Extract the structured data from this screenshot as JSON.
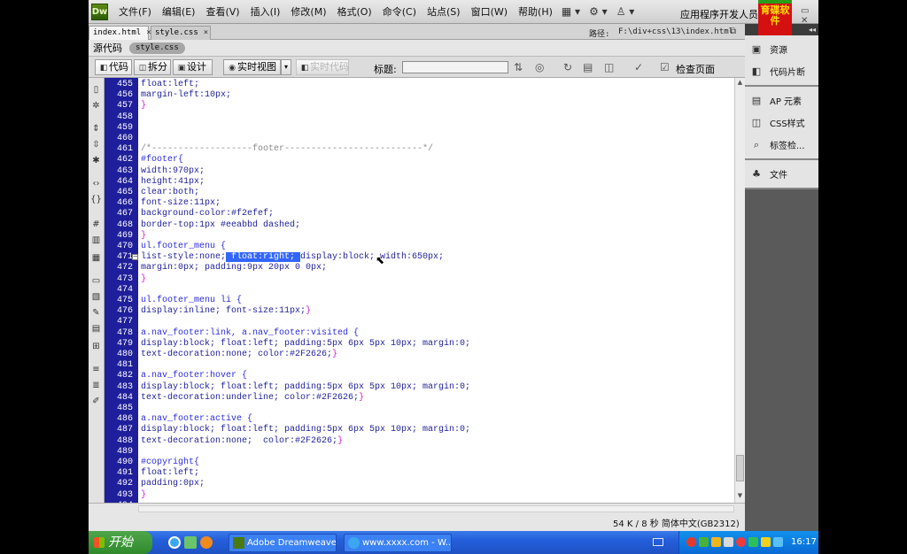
{
  "menubar": {
    "logo_text": "Dw",
    "items": [
      "文件(F)",
      "编辑(E)",
      "查看(V)",
      "插入(I)",
      "修改(M)",
      "格式(O)",
      "命令(C)",
      "站点(S)",
      "窗口(W)",
      "帮助(H)"
    ],
    "tools": [
      "▦ ▾",
      "⚙ ▾",
      "♙ ▾"
    ],
    "workspace": "应用程序开发人员",
    "brand_logo": "育碟软件",
    "window_controls": "▭ ✕"
  },
  "doc_tabs": {
    "tabs": [
      {
        "label": "index.html",
        "close": "×"
      },
      {
        "label": "style.css",
        "close": "×"
      }
    ],
    "path_label": "路径:",
    "path_value": "F:\\div+css\\13\\index.html",
    "restore_icon": "⧉"
  },
  "related_files": {
    "source_code": "源代码",
    "style_file": "style.css"
  },
  "doc_toolbar": {
    "code": "代码",
    "split": "拆分",
    "design": "设计",
    "live_view": "实时视图",
    "live_view_dropdown": "▾",
    "live_code": "实时代码",
    "title_label": "标题:",
    "title_value": "",
    "check_page": "检查页面"
  },
  "editor": {
    "lines": [
      {
        "n": "455",
        "segs": [
          {
            "c": "prop",
            "t": "float:left;"
          }
        ]
      },
      {
        "n": "456",
        "segs": [
          {
            "c": "prop",
            "t": "margin-left:10px;"
          }
        ]
      },
      {
        "n": "457",
        "segs": [
          {
            "c": "brace",
            "t": "}"
          }
        ]
      },
      {
        "n": "458",
        "segs": []
      },
      {
        "n": "459",
        "segs": []
      },
      {
        "n": "460",
        "segs": []
      },
      {
        "n": "461",
        "segs": [
          {
            "c": "comment",
            "t": "/*-------------------footer--------------------------*/"
          }
        ]
      },
      {
        "n": "462",
        "segs": [
          {
            "c": "sel",
            "t": "#footer{"
          }
        ]
      },
      {
        "n": "463",
        "segs": [
          {
            "c": "prop",
            "t": "width:970px;"
          }
        ]
      },
      {
        "n": "464",
        "segs": [
          {
            "c": "prop",
            "t": "height:41px;"
          }
        ]
      },
      {
        "n": "465",
        "segs": [
          {
            "c": "prop",
            "t": "clear:both;"
          }
        ]
      },
      {
        "n": "466",
        "segs": [
          {
            "c": "prop",
            "t": "font-size:11px;"
          }
        ]
      },
      {
        "n": "467",
        "segs": [
          {
            "c": "prop",
            "t": "background-color:#f2efef;"
          }
        ]
      },
      {
        "n": "468",
        "segs": [
          {
            "c": "prop",
            "t": "border-top:1px #eeabbd dashed;"
          }
        ]
      },
      {
        "n": "469",
        "segs": [
          {
            "c": "brace",
            "t": "}"
          }
        ]
      },
      {
        "n": "470",
        "segs": [
          {
            "c": "sel",
            "t": "ul.footer_menu {"
          }
        ]
      },
      {
        "n": "471",
        "fold": "−",
        "segs": [
          {
            "c": "prop",
            "t": "list-style:none;"
          },
          {
            "c": "hl",
            "t": " float:right; "
          },
          {
            "c": "prop",
            "t": "display:block; width:650px;"
          }
        ]
      },
      {
        "n": "472",
        "segs": [
          {
            "c": "prop",
            "t": "margin:0px; padding:9px 20px 0 0px;"
          }
        ]
      },
      {
        "n": "473",
        "segs": [
          {
            "c": "brace",
            "t": "}"
          }
        ]
      },
      {
        "n": "474",
        "segs": []
      },
      {
        "n": "475",
        "segs": [
          {
            "c": "sel",
            "t": "ul.footer_menu li {"
          }
        ]
      },
      {
        "n": "476",
        "segs": [
          {
            "c": "prop",
            "t": "display:inline; font-size:11px;"
          },
          {
            "c": "brace",
            "t": "}"
          }
        ]
      },
      {
        "n": "477",
        "segs": []
      },
      {
        "n": "478",
        "segs": [
          {
            "c": "sel",
            "t": "a.nav_footer:link, a.nav_footer:visited {"
          }
        ]
      },
      {
        "n": "479",
        "segs": [
          {
            "c": "prop",
            "t": "display:block; float:left; padding:5px 6px 5px 10px; margin:0;"
          }
        ]
      },
      {
        "n": "480",
        "segs": [
          {
            "c": "prop",
            "t": "text-decoration:none; color:#2F2626;"
          },
          {
            "c": "brace",
            "t": "}"
          }
        ]
      },
      {
        "n": "481",
        "segs": []
      },
      {
        "n": "482",
        "segs": [
          {
            "c": "sel",
            "t": "a.nav_footer:hover {"
          }
        ]
      },
      {
        "n": "483",
        "segs": [
          {
            "c": "prop",
            "t": "display:block; float:left; padding:5px 6px 5px 10px; margin:0;"
          }
        ]
      },
      {
        "n": "484",
        "segs": [
          {
            "c": "prop",
            "t": "text-decoration:underline; color:#2F2626;"
          },
          {
            "c": "brace",
            "t": "}"
          }
        ]
      },
      {
        "n": "485",
        "segs": []
      },
      {
        "n": "486",
        "segs": [
          {
            "c": "sel",
            "t": "a.nav_footer:active {"
          }
        ]
      },
      {
        "n": "487",
        "segs": [
          {
            "c": "prop",
            "t": "display:block; float:left; padding:5px 6px 5px 10px; margin:0;"
          }
        ]
      },
      {
        "n": "488",
        "segs": [
          {
            "c": "prop",
            "t": "text-decoration:none;  color:#2F2626;"
          },
          {
            "c": "brace",
            "t": "}"
          }
        ]
      },
      {
        "n": "489",
        "segs": []
      },
      {
        "n": "490",
        "segs": [
          {
            "c": "sel",
            "t": "#copyright{"
          }
        ]
      },
      {
        "n": "491",
        "segs": [
          {
            "c": "prop",
            "t": "float:left;"
          }
        ]
      },
      {
        "n": "492",
        "segs": [
          {
            "c": "prop",
            "t": "padding:0px;"
          }
        ]
      },
      {
        "n": "493",
        "segs": [
          {
            "c": "brace",
            "t": "}"
          }
        ]
      },
      {
        "n": "494",
        "segs": []
      }
    ]
  },
  "status_bar": {
    "text": "54 K / 8 秒  简体中文(GB2312)"
  },
  "right_panel": {
    "strip": "◂◂",
    "groups": [
      [
        {
          "icon": "▣",
          "label": "资源"
        },
        {
          "icon": "◧",
          "label": "代码片断"
        }
      ],
      [
        {
          "icon": "▤",
          "label": "AP 元素"
        },
        {
          "icon": "◫",
          "label": "CSS样式"
        },
        {
          "icon": "⌕",
          "label": "标签检..."
        }
      ],
      [
        {
          "icon": "♣",
          "label": "文件"
        }
      ]
    ]
  },
  "taskbar": {
    "start": "开始",
    "tasks": [
      "Adobe Dreamweave...",
      "www.xxxx.com - W..."
    ],
    "clock": "16:17"
  }
}
